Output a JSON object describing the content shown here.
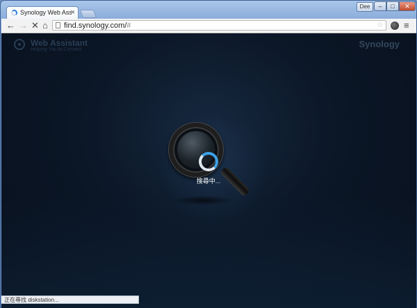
{
  "browser": {
    "tab": {
      "title": "Synology Web Assistant",
      "close_label": "×"
    },
    "user_label": "Dee",
    "window_buttons": {
      "minimize": "–",
      "maximize": "□",
      "close": "✕"
    },
    "toolbar": {
      "back": "←",
      "forward": "→",
      "stop": "✕",
      "home": "⌂",
      "url_host": "find.synology.com/",
      "url_fragment": "#",
      "star": "☆",
      "menu": "≡"
    },
    "status_text": "正在尋找 diskstation..."
  },
  "page": {
    "app_title": "Web Assistant",
    "tagline": "Helping You to Connect",
    "brand": "Synology",
    "searching_text": "搜尋中..."
  },
  "colors": {
    "spinner_accent": "#3da1e6",
    "background_dark": "#08101c"
  },
  "icons": {
    "back": "back-arrow-icon",
    "forward": "forward-arrow-icon",
    "stop": "stop-icon",
    "home": "home-icon",
    "page": "page-icon",
    "star": "star-icon",
    "extension": "extension-icon",
    "menu": "menu-icon",
    "loading": "spinner-icon",
    "search": "magnifier-icon"
  }
}
